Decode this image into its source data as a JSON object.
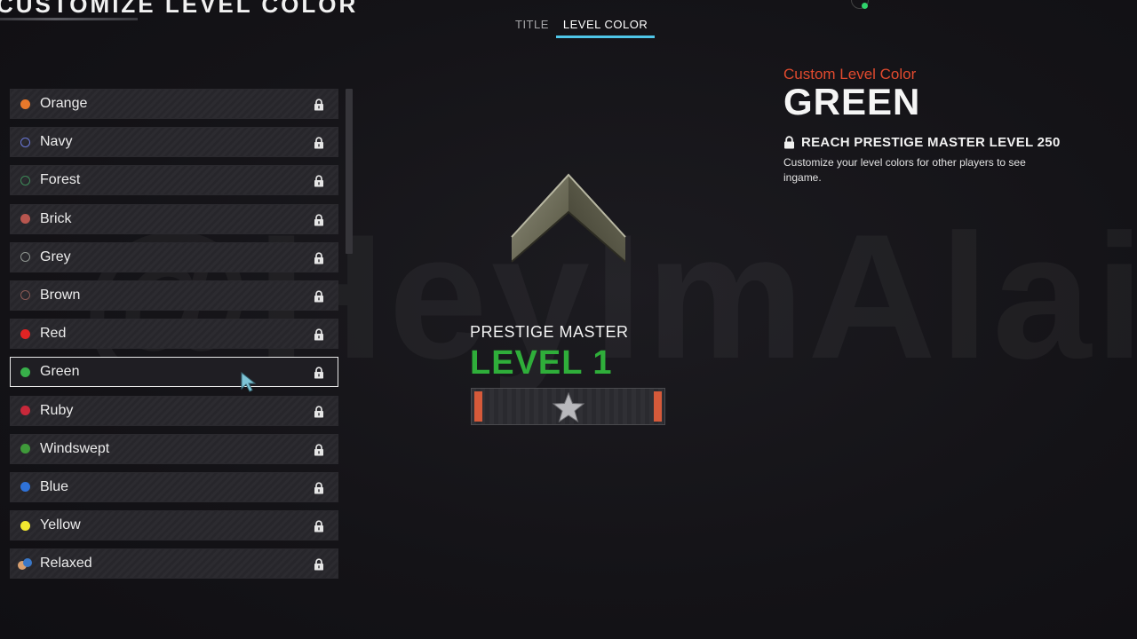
{
  "header": {
    "title": "CUSTOMIZE LEVEL COLOR",
    "tabs": [
      {
        "label": "TITLE",
        "active": false
      },
      {
        "label": "LEVEL COLOR",
        "active": true
      }
    ]
  },
  "colors": [
    {
      "label": "Orange",
      "color": "#e8782b",
      "style": "solid",
      "locked": true
    },
    {
      "label": "Navy",
      "color": "#6a78d8",
      "style": "hollow",
      "locked": true
    },
    {
      "label": "Forest",
      "color": "#3e8a58",
      "style": "hollow",
      "locked": true
    },
    {
      "label": "Brick",
      "color": "#b8564f",
      "style": "solid",
      "locked": true
    },
    {
      "label": "Grey",
      "color": "#8f9590",
      "style": "hollow",
      "locked": true
    },
    {
      "label": "Brown",
      "color": "#8a5a55",
      "style": "hollow",
      "locked": true
    },
    {
      "label": "Red",
      "color": "#e02424",
      "style": "solid",
      "locked": true
    },
    {
      "label": "Green",
      "color": "#38b04a",
      "style": "solid",
      "locked": true,
      "selected": true
    },
    {
      "label": "Ruby",
      "color": "#c8283a",
      "style": "solid",
      "locked": true
    },
    {
      "label": "Windswept",
      "color": "#3f9a3a",
      "style": "solid",
      "locked": true
    },
    {
      "label": "Blue",
      "color": "#2f72d8",
      "style": "solid",
      "locked": true
    },
    {
      "label": "Yellow",
      "color": "#f2e830",
      "style": "solid",
      "locked": true
    },
    {
      "label": "Relaxed",
      "color": "#d8a070",
      "color2": "#3a78c8",
      "style": "dual",
      "locked": true
    }
  ],
  "preview": {
    "rank_name": "PRESTIGE MASTER",
    "rank_level": "LEVEL 1"
  },
  "detail": {
    "subtitle": "Custom Level Color",
    "name": "GREEN",
    "requirement": "REACH PRESTIGE MASTER LEVEL 250",
    "description": "Customize your level colors for other players to see ingame."
  },
  "watermark": "@HeyImAlaix",
  "theme": {
    "accent": "#4fc6e8",
    "selected_color": "#2fae3a",
    "subtitle_color": "#e14a2e"
  }
}
